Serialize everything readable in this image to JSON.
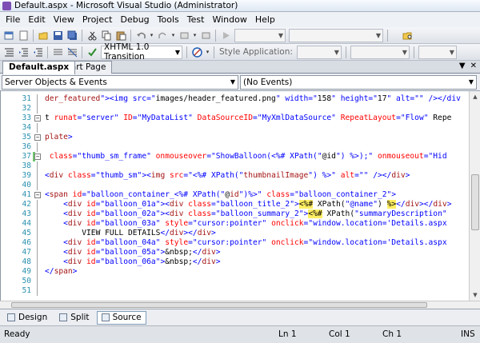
{
  "window": {
    "title": "Default.aspx - Microsoft Visual Studio (Administrator)"
  },
  "menu": [
    "File",
    "Edit",
    "View",
    "Project",
    "Debug",
    "Tools",
    "Test",
    "Window",
    "Help"
  ],
  "toolbar2": {
    "doctype_combo": "XHTML 1.0 Transition",
    "style_application_label": "Style Application:"
  },
  "doc_tabs": [
    {
      "label": "Default.aspx",
      "active": true
    },
    {
      "label": "Start Page",
      "active": false
    }
  ],
  "nav": {
    "objects_combo": "Server Objects & Events",
    "events_combo": "(No Events)"
  },
  "editor": {
    "lines": [
      {
        "n": "31",
        "text": "der_featured\"><img src=\"images/header_featured.png\" width=\"158\" height=\"17\" alt=\"\" /></div"
      },
      {
        "n": "32",
        "text": ""
      },
      {
        "n": "33",
        "text": "t runat=\"server\" ID=\"MyDataList\" DataSourceID=\"MyXmlDataSource\" RepeatLayout=\"Flow\" Repe"
      },
      {
        "n": "34",
        "text": ""
      },
      {
        "n": "35",
        "text": "plate>"
      },
      {
        "n": "36",
        "text": ""
      },
      {
        "n": "37",
        "text": " class=\"thumb_sm_frame\" onmouseover=\"ShowBalloon(<%# XPath(\"@id\") %>);\" onmouseout=\"Hid"
      },
      {
        "n": "38",
        "text": ""
      },
      {
        "n": "39",
        "text": "<div class=\"thumb_sm\"><img src=\"<%# XPath(\"thumbnailImage\") %>\" alt=\"\" /></div>"
      },
      {
        "n": "40",
        "text": ""
      },
      {
        "n": "41",
        "text": "<span id=\"balloon_container_<%# XPath(\"@id\")%>\" class=\"balloon_container_2\">"
      },
      {
        "n": "42",
        "text": "    <div id=\"balloon_01a\"><div class=\"balloon_title_2\"><%# XPath(\"@name\") %></div></div>"
      },
      {
        "n": "43",
        "text": "    <div id=\"balloon_02a\"><div class=\"balloon_summary_2\"><%# XPath(\"summaryDescription\""
      },
      {
        "n": "44",
        "text": "    <div id=\"balloon_03a\" style=\"cursor:pointer\" onclick=\"window.location='Details.aspx"
      },
      {
        "n": "45",
        "text": "        VIEW FULL DETAILS</div></div>"
      },
      {
        "n": "46",
        "text": "    <div id=\"balloon_04a\" style=\"cursor:pointer\" onclick=\"window.location='Details.aspx"
      },
      {
        "n": "47",
        "text": "    <div id=\"balloon_05a\">&nbsp;</div>"
      },
      {
        "n": "48",
        "text": "    <div id=\"balloon_06a\">&nbsp;</div>"
      },
      {
        "n": "49",
        "text": "</span>"
      },
      {
        "n": "50",
        "text": ""
      },
      {
        "n": "51",
        "text": ""
      }
    ]
  },
  "view_tabs": [
    {
      "label": "Design",
      "active": false
    },
    {
      "label": "Split",
      "active": false
    },
    {
      "label": "Source",
      "active": true
    }
  ],
  "status": {
    "ready": "Ready",
    "ln": "Ln 1",
    "col": "Col 1",
    "ch": "Ch 1",
    "ins": "INS"
  },
  "colors": {
    "tag": "#a31515",
    "attribute": "#ff0000",
    "value": "#0000ff",
    "server_block_highlight": "#ffee62",
    "line_number": "#2b91af"
  }
}
